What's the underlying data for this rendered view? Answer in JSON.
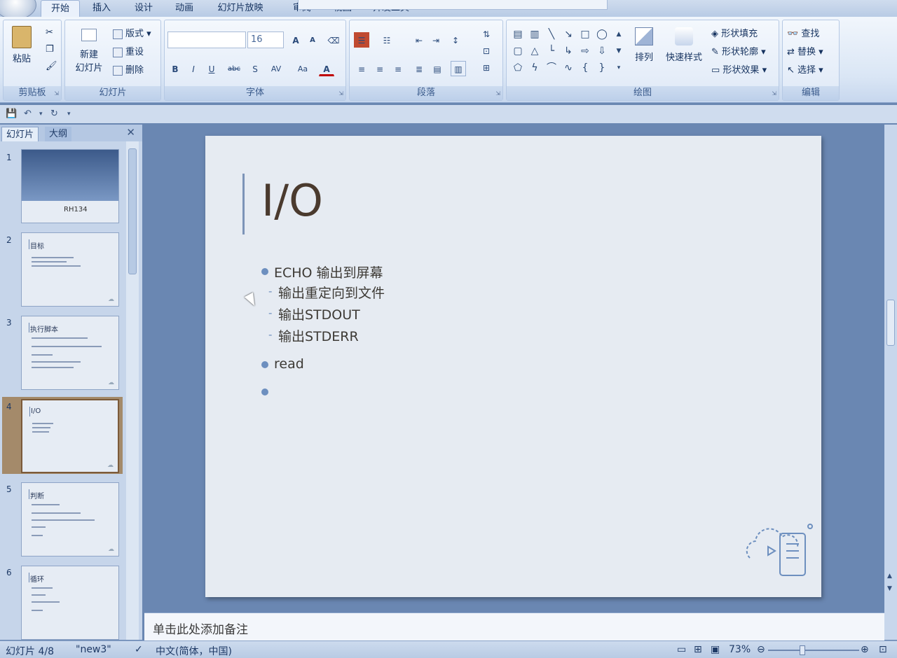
{
  "tabs": [
    {
      "label": "开始"
    },
    {
      "label": "插入"
    },
    {
      "label": "设计"
    },
    {
      "label": "动画"
    },
    {
      "label": "幻灯片放映"
    },
    {
      "label": "审阅"
    },
    {
      "label": "视图"
    },
    {
      "label": "开发工具"
    }
  ],
  "ribbon": {
    "clipboard": {
      "paste": "粘贴",
      "group": "剪贴板"
    },
    "slides": {
      "new_slide_1": "新建",
      "new_slide_2": "幻灯片",
      "layout": "版式",
      "reset": "重设",
      "delete": "删除",
      "group": "幻灯片"
    },
    "font": {
      "size": "16",
      "bold": "B",
      "italic": "I",
      "underline": "U",
      "strike": "abc",
      "shadow": "S",
      "spacing": "AV",
      "case": "Aa",
      "color": "A",
      "grow": "A",
      "shrink": "A",
      "group": "字体"
    },
    "paragraph": {
      "group": "段落"
    },
    "drawing": {
      "arrange": "排列",
      "quick_styles": "快速样式",
      "shape_fill": "形状填充",
      "shape_outline": "形状轮廓",
      "shape_effects": "形状效果",
      "group": "绘图"
    },
    "editing": {
      "find": "查找",
      "replace": "替换",
      "select": "选择",
      "group": "编辑"
    }
  },
  "pane": {
    "tab_slides": "幻灯片",
    "tab_outline": "大纲",
    "thumbs": [
      {
        "num": "1",
        "title": "",
        "sub": "RH134"
      },
      {
        "num": "2",
        "title": "目标",
        "sub": ""
      },
      {
        "num": "3",
        "title": "执行脚本",
        "sub": ""
      },
      {
        "num": "4",
        "title": "I/O",
        "sub": ""
      },
      {
        "num": "5",
        "title": "判断",
        "sub": ""
      },
      {
        "num": "6",
        "title": "循环",
        "sub": ""
      }
    ]
  },
  "slide": {
    "title": "I/O",
    "bullets": [
      {
        "text": "ECHO  输出到屏幕",
        "level": 1
      },
      {
        "text": "输出重定向到文件",
        "level": 2
      },
      {
        "text": "输出STDOUT",
        "level": 2
      },
      {
        "text": "输出STDERR",
        "level": 2
      },
      {
        "text": "read",
        "level": 1
      },
      {
        "text": "",
        "level": 1
      }
    ]
  },
  "notes": {
    "placeholder": "单击此处添加备注"
  },
  "status": {
    "slide_counter": "幻灯片 4/8",
    "theme": "\"new3\"",
    "language": "中文(简体，中国)",
    "zoom": "73%"
  }
}
